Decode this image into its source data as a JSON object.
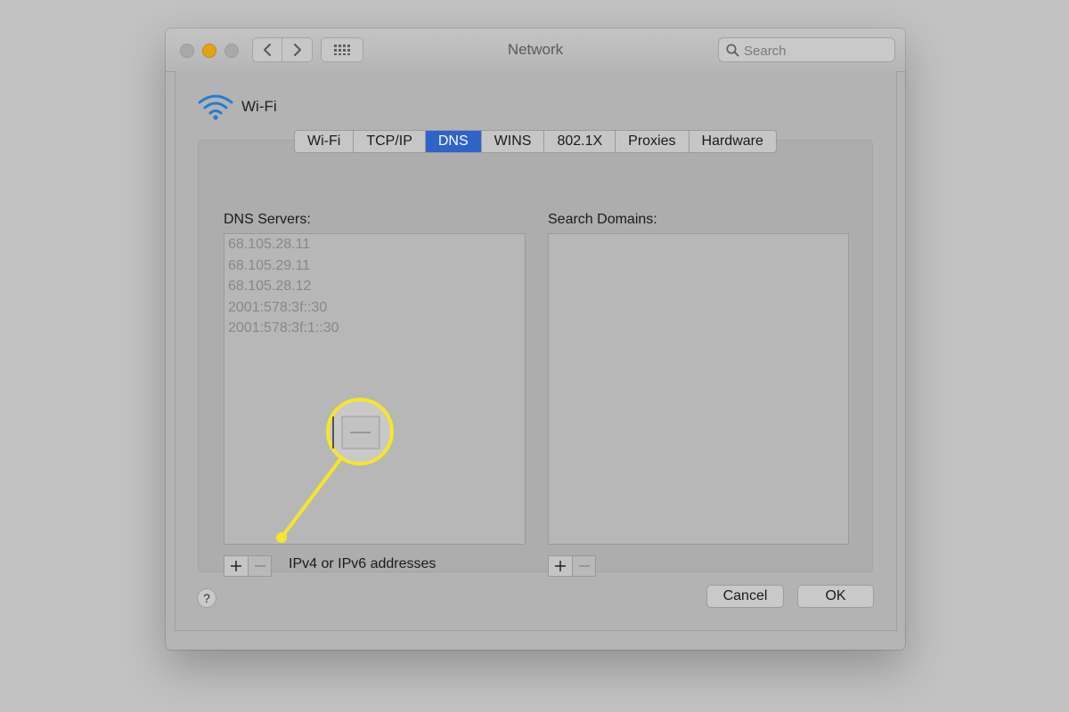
{
  "window": {
    "title": "Network",
    "search_placeholder": "Search"
  },
  "service": {
    "name": "Wi-Fi",
    "icon": "wifi-icon"
  },
  "tabs": [
    {
      "label": "Wi-Fi",
      "active": false
    },
    {
      "label": "TCP/IP",
      "active": false
    },
    {
      "label": "DNS",
      "active": true
    },
    {
      "label": "WINS",
      "active": false
    },
    {
      "label": "802.1X",
      "active": false
    },
    {
      "label": "Proxies",
      "active": false
    },
    {
      "label": "Hardware",
      "active": false
    }
  ],
  "dns": {
    "label": "DNS Servers:",
    "servers": [
      "68.105.28.11",
      "68.105.29.11",
      "68.105.28.12",
      "2001:578:3f::30",
      "2001:578:3f:1::30"
    ],
    "hint": "IPv4 or IPv6 addresses",
    "add_label": "+",
    "remove_label": "—"
  },
  "search_domains": {
    "label": "Search Domains:",
    "domains": [],
    "add_label": "+",
    "remove_label": "—"
  },
  "footer": {
    "help_label": "?",
    "cancel_label": "Cancel",
    "ok_label": "OK"
  },
  "colors": {
    "accent": "#2f63c9",
    "highlight": "#f5e62a",
    "minimize": "#e0a41c"
  }
}
